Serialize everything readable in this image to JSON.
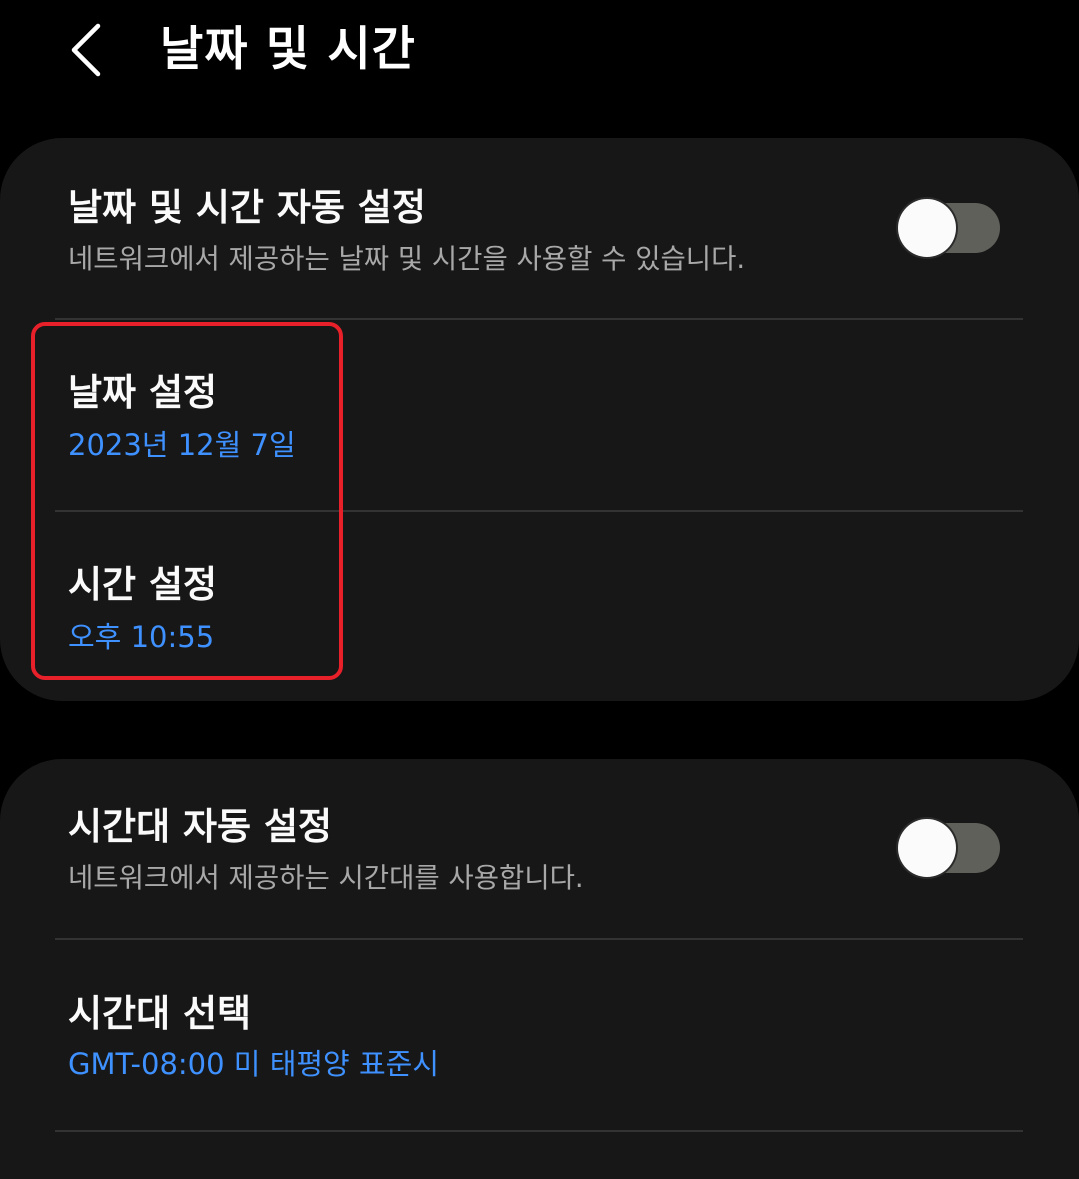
{
  "header": {
    "title": "날짜 및 시간",
    "back_icon": "chevron-left-icon"
  },
  "card_datetime": {
    "auto_datetime": {
      "title": "날짜 및 시간 자동 설정",
      "subtitle": "네트워크에서 제공하는 날짜 및 시간을 사용할 수 있습니다.",
      "toggle_on": false
    },
    "set_date": {
      "title": "날짜 설정",
      "value": "2023년 12월 7일"
    },
    "set_time": {
      "title": "시간 설정",
      "value": "오후 10:55"
    }
  },
  "card_timezone": {
    "auto_timezone": {
      "title": "시간대 자동 설정",
      "subtitle": "네트워크에서 제공하는 시간대를 사용합니다.",
      "toggle_on": false
    },
    "select_timezone": {
      "title": "시간대 선택",
      "value": "GMT-08:00 미 태평양 표준시"
    }
  },
  "colors": {
    "background": "#000000",
    "card": "#171717",
    "accent_value": "#3e91ff",
    "highlight_box": "#e8202a",
    "toggle_track_off": "#60605b"
  }
}
